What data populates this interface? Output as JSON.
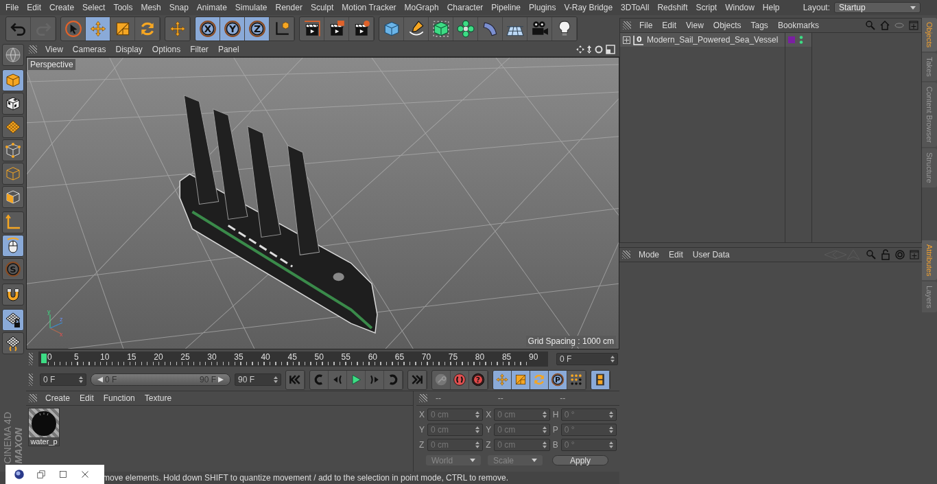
{
  "menu_bar": {
    "items": [
      "File",
      "Edit",
      "Create",
      "Select",
      "Tools",
      "Mesh",
      "Snap",
      "Animate",
      "Simulate",
      "Render",
      "Sculpt",
      "Motion Tracker",
      "MoGraph",
      "Character",
      "Pipeline",
      "Plugins",
      "V-Ray Bridge",
      "3DToAll",
      "Redshift",
      "Script",
      "Window",
      "Help"
    ],
    "layout_label": "Layout:",
    "layout_value": "Startup"
  },
  "toolbar": {
    "groups": [
      [
        {
          "kind": "undo",
          "selected": false,
          "disabled": false
        },
        {
          "kind": "redo",
          "selected": false,
          "disabled": true
        }
      ],
      [
        {
          "kind": "select",
          "selected": false,
          "disabled": false
        },
        {
          "kind": "move",
          "selected": true,
          "disabled": false
        },
        {
          "kind": "scale",
          "selected": false,
          "disabled": false
        },
        {
          "kind": "rotate",
          "selected": false,
          "disabled": false
        }
      ],
      [
        {
          "kind": "move",
          "selected": false,
          "disabled": false
        }
      ],
      [
        {
          "kind": "letter",
          "label": "X",
          "selected": true,
          "disabled": false
        },
        {
          "kind": "letter",
          "label": "Y",
          "selected": true,
          "disabled": false
        },
        {
          "kind": "letter",
          "label": "Z",
          "selected": true,
          "disabled": false
        },
        {
          "kind": "coord",
          "selected": false,
          "disabled": false
        }
      ],
      [
        {
          "kind": "render_view",
          "selected": false,
          "disabled": false
        },
        {
          "kind": "render",
          "selected": false,
          "disabled": false
        },
        {
          "kind": "render_settings",
          "selected": false,
          "disabled": false
        }
      ],
      [
        {
          "kind": "cube",
          "selected": false,
          "disabled": false
        },
        {
          "kind": "pen",
          "selected": false,
          "disabled": false
        },
        {
          "kind": "subdiv",
          "selected": false,
          "disabled": false
        },
        {
          "kind": "cloner",
          "selected": false,
          "disabled": false
        },
        {
          "kind": "deformer",
          "selected": false,
          "disabled": false
        },
        {
          "kind": "floor",
          "selected": false,
          "disabled": false
        },
        {
          "kind": "camera",
          "selected": false,
          "disabled": false
        },
        {
          "kind": "light",
          "selected": false,
          "disabled": false
        }
      ]
    ]
  },
  "left_tools": [
    {
      "kind": "globe",
      "selected": false
    },
    {
      "kind": "model",
      "selected": true
    },
    {
      "kind": "texture",
      "selected": false
    },
    {
      "kind": "workplane",
      "selected": false
    },
    {
      "kind": "points",
      "selected": false
    },
    {
      "kind": "edges",
      "selected": false
    },
    {
      "kind": "polygons",
      "selected": false
    },
    {
      "kind": "axis",
      "selected": false
    },
    {
      "kind": "tweak",
      "selected": true
    },
    {
      "kind": "letter",
      "label": "S",
      "selected": false
    },
    {
      "kind": "magnet",
      "selected": false
    },
    {
      "kind": "workplane_lock",
      "selected": true
    },
    {
      "kind": "workplane_sync",
      "selected": false
    }
  ],
  "logo": {
    "brand": "MAXON",
    "product": "CINEMA 4D"
  },
  "viewport": {
    "menu": [
      "View",
      "Cameras",
      "Display",
      "Options",
      "Filter",
      "Panel"
    ],
    "camera": "Perspective",
    "grid_spacing": "Grid Spacing : 1000 cm",
    "axis_labels": [
      "y",
      "z",
      "x"
    ]
  },
  "timeline": {
    "ticks": [
      "0",
      "5",
      "10",
      "15",
      "20",
      "25",
      "30",
      "35",
      "40",
      "45",
      "50",
      "55",
      "60",
      "65",
      "70",
      "75",
      "80",
      "85",
      "90"
    ],
    "playhead": {
      "level": 0
    },
    "current_frame": "0 F"
  },
  "transport": {
    "start": "0 F",
    "range_start": "0 F",
    "range_end": "90 F",
    "range": {
      "level": 1
    },
    "end": "90 F",
    "groups": [
      [
        {
          "kind": "first",
          "selected": false
        }
      ],
      [
        {
          "kind": "prev_key",
          "selected": false
        },
        {
          "kind": "prev_frame",
          "selected": false
        },
        {
          "kind": "play",
          "selected": false
        },
        {
          "kind": "next_frame",
          "selected": false
        },
        {
          "kind": "next_key",
          "selected": false
        }
      ],
      [
        {
          "kind": "last",
          "selected": false
        }
      ],
      [
        {
          "kind": "record",
          "selected": false
        },
        {
          "kind": "autokey",
          "selected": false
        },
        {
          "kind": "letter_red",
          "label": "?",
          "selected": false
        }
      ],
      [
        {
          "kind": "move",
          "selected": true
        },
        {
          "kind": "scale",
          "selected": true
        },
        {
          "kind": "rotate",
          "selected": true
        },
        {
          "kind": "letter",
          "label": "P",
          "selected": true
        },
        {
          "kind": "dots",
          "selected": false
        }
      ],
      [
        {
          "kind": "film",
          "selected": true
        }
      ]
    ]
  },
  "materials": {
    "menu": [
      "Create",
      "Edit",
      "Function",
      "Texture"
    ],
    "items": [
      {
        "name": "water_p"
      }
    ]
  },
  "coordinates": {
    "headers": [
      "--",
      "--",
      "--"
    ],
    "columns": [
      [
        {
          "axis": "X",
          "value": "0 cm"
        },
        {
          "axis": "Y",
          "value": "0 cm"
        },
        {
          "axis": "Z",
          "value": "0 cm"
        }
      ],
      [
        {
          "axis": "X",
          "value": "0 cm"
        },
        {
          "axis": "Y",
          "value": "0 cm"
        },
        {
          "axis": "Z",
          "value": "0 cm"
        }
      ],
      [
        {
          "axis": "H",
          "value": "0 °"
        },
        {
          "axis": "P",
          "value": "0 °"
        },
        {
          "axis": "B",
          "value": "0 °"
        }
      ]
    ],
    "space": "World",
    "mode": "Scale",
    "apply": "Apply"
  },
  "status_bar": "move elements. Hold down SHIFT to quantize movement / add to the selection in point mode, CTRL to remove.",
  "window_buttons": [
    {
      "kind": "app"
    },
    {
      "kind": "restore"
    },
    {
      "kind": "maximize"
    },
    {
      "kind": "close"
    }
  ],
  "objects_manager": {
    "menu": [
      "File",
      "Edit",
      "View",
      "Objects",
      "Tags",
      "Bookmarks"
    ],
    "objects": [
      {
        "name": "Modern_Sail_Powered_Sea_Vessel",
        "icon_label": "0",
        "expanded": false,
        "color": "#7b1fa2"
      }
    ]
  },
  "attributes": {
    "menu": [
      "Mode",
      "Edit",
      "User Data"
    ]
  },
  "side_tabs_top": [
    {
      "label": "Objects",
      "selected": true
    },
    {
      "label": "Takes",
      "selected": false
    },
    {
      "label": "Content Browser",
      "selected": false
    },
    {
      "label": "Structure",
      "selected": false
    }
  ],
  "side_tabs_bottom": [
    {
      "label": "Attributes",
      "selected": true
    },
    {
      "label": "Layers",
      "selected": false
    }
  ]
}
